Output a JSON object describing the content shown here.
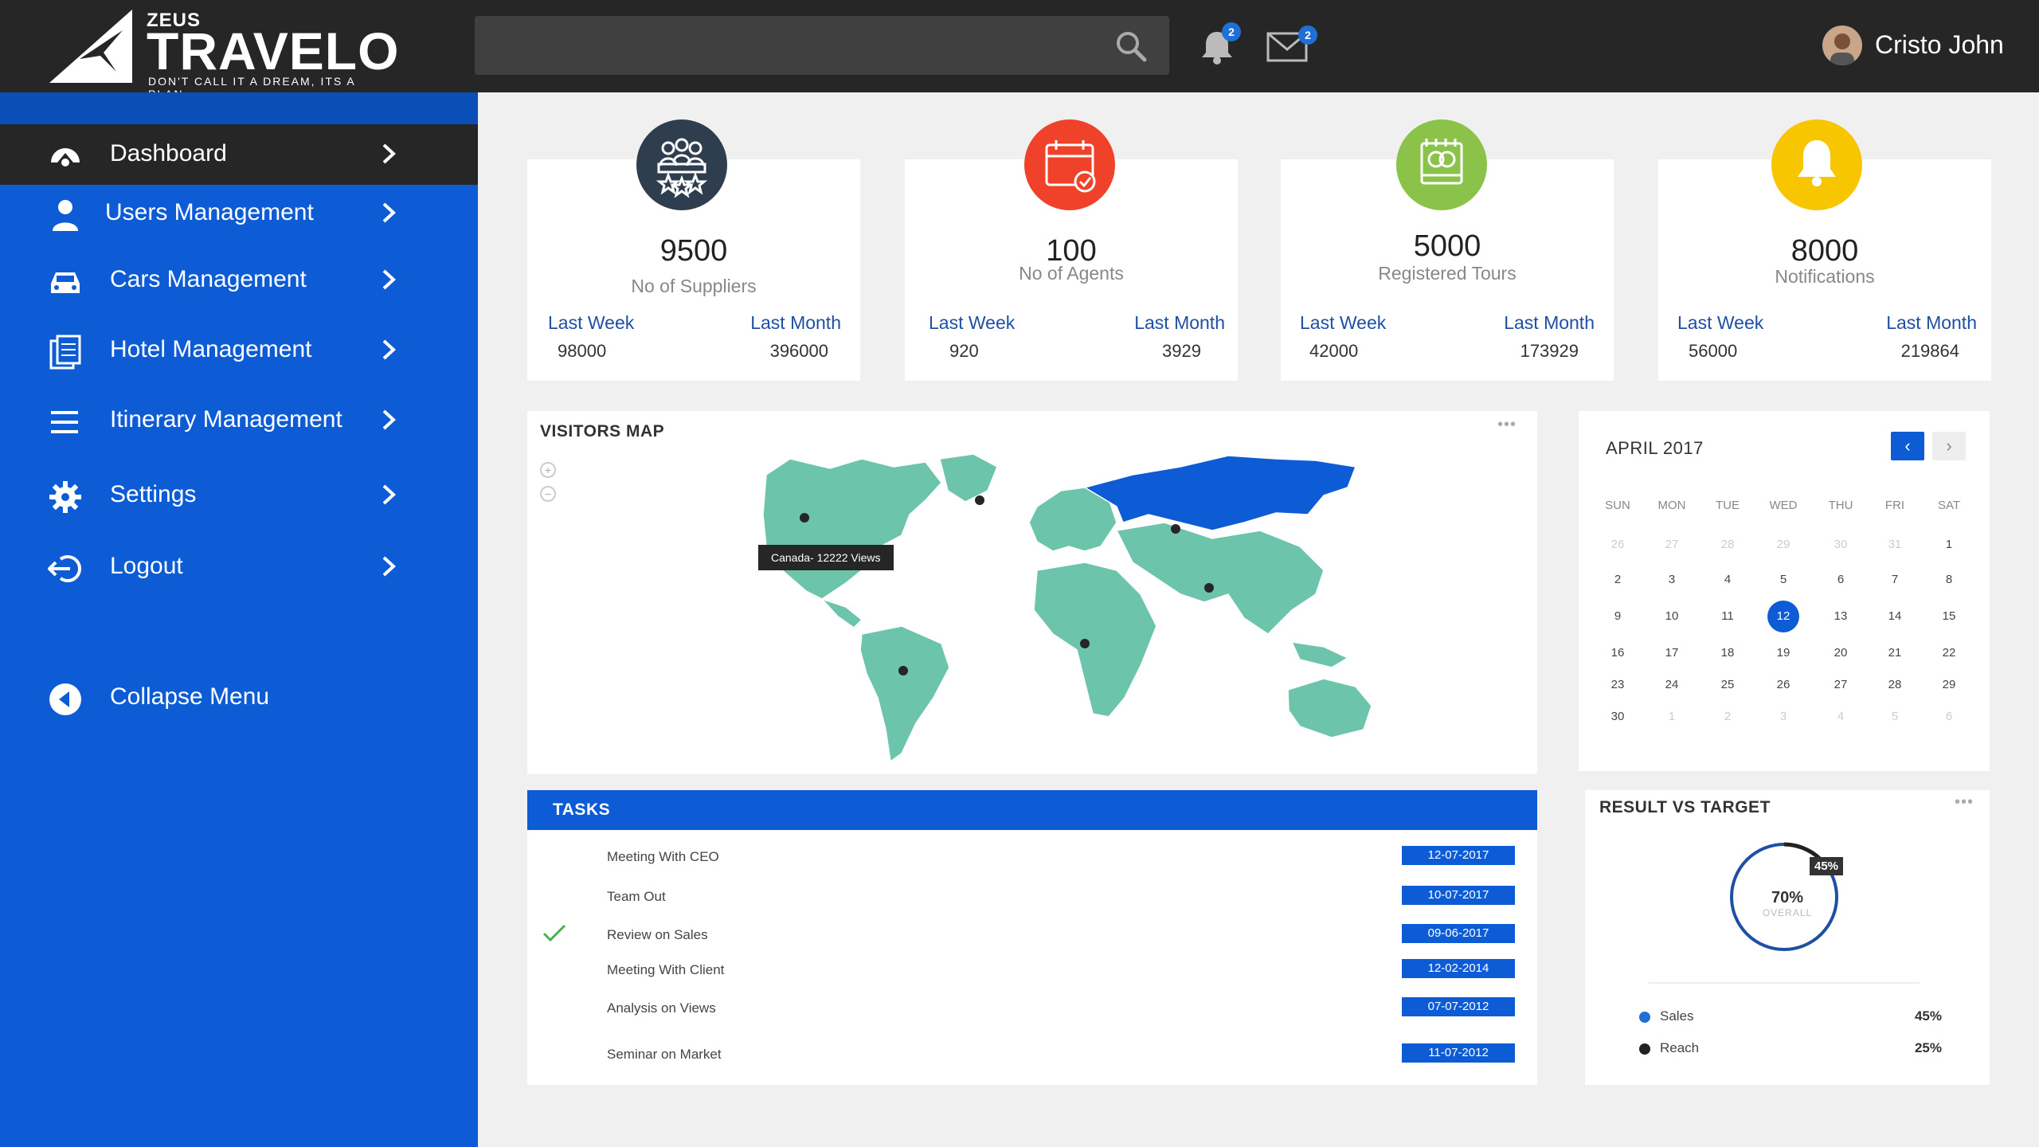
{
  "brand": {
    "small": "ZEUS",
    "wordmark": "TRAVELO",
    "tagline": "DON'T CALL IT A DREAM, ITS A PLAN"
  },
  "header": {
    "search_placeholder": "",
    "notifications_count": "2",
    "messages_count": "2",
    "user_name": "Cristo John"
  },
  "sidebar": {
    "items": [
      {
        "label": "Dashboard",
        "icon": "dashboard-icon"
      },
      {
        "label": "Users Management",
        "icon": "user-icon"
      },
      {
        "label": "Cars Management",
        "icon": "car-icon"
      },
      {
        "label": "Hotel Management",
        "icon": "document-icon"
      },
      {
        "label": "Itinerary Management",
        "icon": "list-icon"
      },
      {
        "label": "Settings",
        "icon": "gear-icon"
      },
      {
        "label": "Logout",
        "icon": "logout-icon"
      }
    ],
    "collapse_label": "Collapse Menu"
  },
  "stats": [
    {
      "value": "9500",
      "label": "No of Suppliers",
      "last_week_label": "Last Week",
      "last_month_label": "Last Month",
      "last_week": "98000",
      "last_month": "396000",
      "color": "#2f3e4e",
      "icon": "suppliers-icon"
    },
    {
      "value": "100",
      "label": "No of Agents",
      "last_week_label": "Last Week",
      "last_month_label": "Last Month",
      "last_week": "920",
      "last_month": "3929",
      "color": "#f0412b",
      "icon": "calendar-check-icon"
    },
    {
      "value": "5000",
      "label": "Registered Tours",
      "last_week_label": "Last Week",
      "last_month_label": "Last Month",
      "last_week": "42000",
      "last_month": "173929",
      "color": "#8bc34a",
      "icon": "tours-icon"
    },
    {
      "value": "8000",
      "label": "Notifications",
      "last_week_label": "Last Week",
      "last_month_label": "Last Month",
      "last_week": "56000",
      "last_month": "219864",
      "color": "#f7c600",
      "icon": "bell-icon"
    }
  ],
  "visitors_map": {
    "title": "VISITORS MAP",
    "tooltip": "Canada- 12222 Views",
    "land_color": "#6cc4aa",
    "highlight_color": "#0d5cd6"
  },
  "calendar": {
    "month_label": "APRIL 2017",
    "weekdays": [
      "SUN",
      "MON",
      "TUE",
      "WED",
      "THU",
      "FRI",
      "SAT"
    ],
    "weeks": [
      [
        "26",
        "27",
        "28",
        "29",
        "30",
        "31",
        "1"
      ],
      [
        "2",
        "3",
        "4",
        "5",
        "6",
        "7",
        "8"
      ],
      [
        "9",
        "10",
        "11",
        "12",
        "13",
        "14",
        "15"
      ],
      [
        "16",
        "17",
        "18",
        "19",
        "20",
        "21",
        "22"
      ],
      [
        "23",
        "24",
        "25",
        "26",
        "27",
        "28",
        "29"
      ],
      [
        "30",
        "1",
        "2",
        "3",
        "4",
        "5",
        "6"
      ]
    ],
    "today": "12"
  },
  "tasks": {
    "title": "TASKS",
    "rows": [
      {
        "name": "Meeting With CEO",
        "date": "12-07-2017",
        "done": false
      },
      {
        "name": "Team Out",
        "date": "10-07-2017",
        "done": false
      },
      {
        "name": "Review on Sales",
        "date": "09-06-2017",
        "done": true
      },
      {
        "name": "Meeting With Client",
        "date": "12-02-2014",
        "done": false
      },
      {
        "name": "Analysis on Views",
        "date": "07-07-2012",
        "done": false
      },
      {
        "name": "Seminar on Market",
        "date": "11-07-2012",
        "done": false
      }
    ]
  },
  "result": {
    "title": "RESULT VS TARGET",
    "overall_value": "70%",
    "overall_label": "OVERALL",
    "badge": "45%",
    "legend": [
      {
        "name": "Sales",
        "value": "45%",
        "color": "#1f6fd6"
      },
      {
        "name": "Reach",
        "value": "25%",
        "color": "#222222"
      }
    ]
  }
}
